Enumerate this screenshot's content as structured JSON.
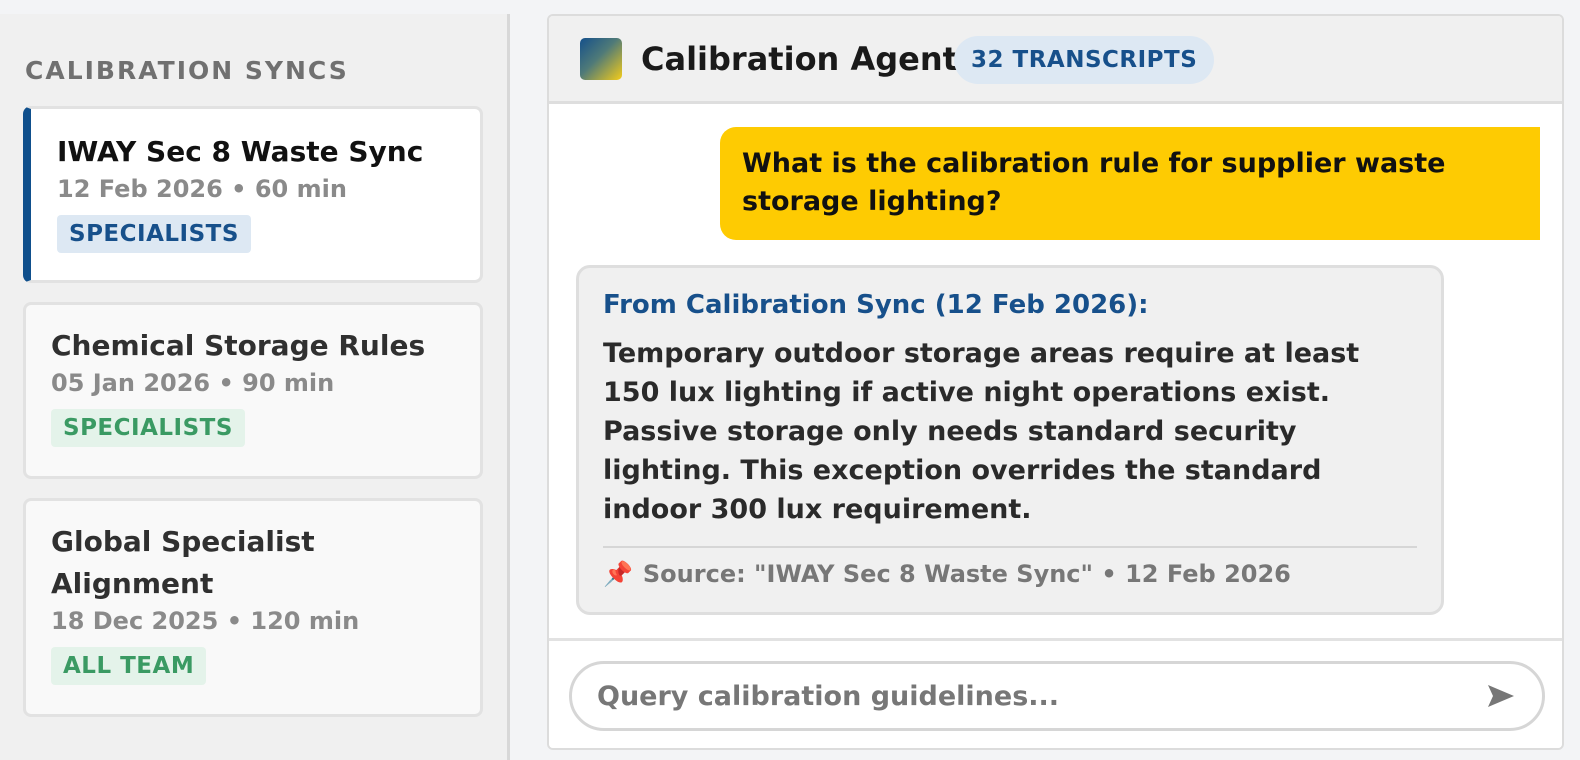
{
  "sidebar": {
    "title": "CALIBRATION SYNCS",
    "syncs": [
      {
        "title": "IWAY Sec 8 Waste Sync",
        "meta": "12 Feb 2026 • 60 min",
        "tag": "SPECIALISTS",
        "active": true,
        "tag_color": "#17508b"
      },
      {
        "title": "Chemical Storage Rules",
        "meta": "05 Jan 2026 • 90 min",
        "tag": "SPECIALISTS",
        "active": false,
        "tag_color": "#3a9a63"
      },
      {
        "title": "Global Specialist Alignment",
        "meta": "18 Dec 2025 • 120 min",
        "tag": "ALL TEAM",
        "active": false,
        "tag_color": "#3a9a63"
      }
    ]
  },
  "chat": {
    "title": "Calibration Agent",
    "badge": "32 TRANSCRIPTS",
    "user_message": "What is the calibration rule for supplier waste storage lighting?",
    "agent_response": {
      "from_label": "From Calibration Sync (12 Feb 2026):",
      "text": "Temporary outdoor storage areas require at least 150 lux lighting if active night operations exist. Passive storage only needs standard security lighting. This exception overrides the standard indoor 300 lux requirement.",
      "source_icon": "pin-icon",
      "source": "Source: \"IWAY Sec 8 Waste Sync\" • 12 Feb 2026"
    },
    "input": {
      "placeholder": "Query calibration guidelines...",
      "value": ""
    },
    "send_icon": "send-icon"
  },
  "colors": {
    "accent_blue": "#17508b",
    "user_bubble": "#fecb02",
    "tag_green": "#3a9a63"
  }
}
